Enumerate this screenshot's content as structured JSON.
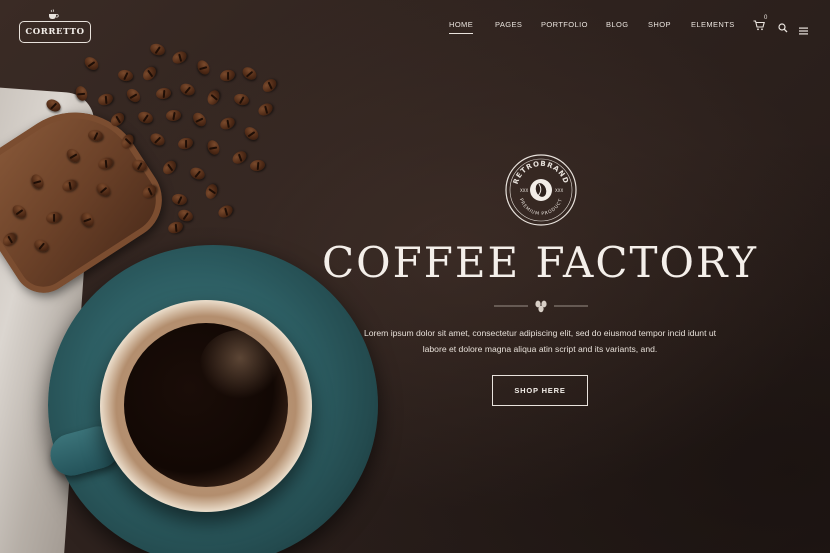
{
  "brand": {
    "logo_text": "CORRETTO"
  },
  "nav": {
    "items": [
      {
        "label": "HOME",
        "active": true
      },
      {
        "label": "PAGES"
      },
      {
        "label": "PORTFOLIO"
      },
      {
        "label": "BLOG"
      },
      {
        "label": "SHOP"
      },
      {
        "label": "ELEMENTS"
      }
    ],
    "cart_count": "0",
    "icons": [
      "cart-icon",
      "search-icon",
      "menu-icon"
    ]
  },
  "hero": {
    "badge_top_text": "RETROBRAND",
    "badge_bottom_text": "PREMIUM PRODUCT",
    "badge_left": "XXX",
    "badge_right": "XXX",
    "title": "COFFEE FACTORY",
    "description_line1": "Lorem ipsum dolor sit amet, consectetur adipiscing elit, sed do eiusmod tempor incid idunt ut",
    "description_line2": "labore et dolore magna aliqua atin script and its variants, and.",
    "cta_label": "SHOP HERE"
  },
  "colors": {
    "background": "#2e221e",
    "text": "#f4efea",
    "cup_teal": "#2d5e63"
  }
}
